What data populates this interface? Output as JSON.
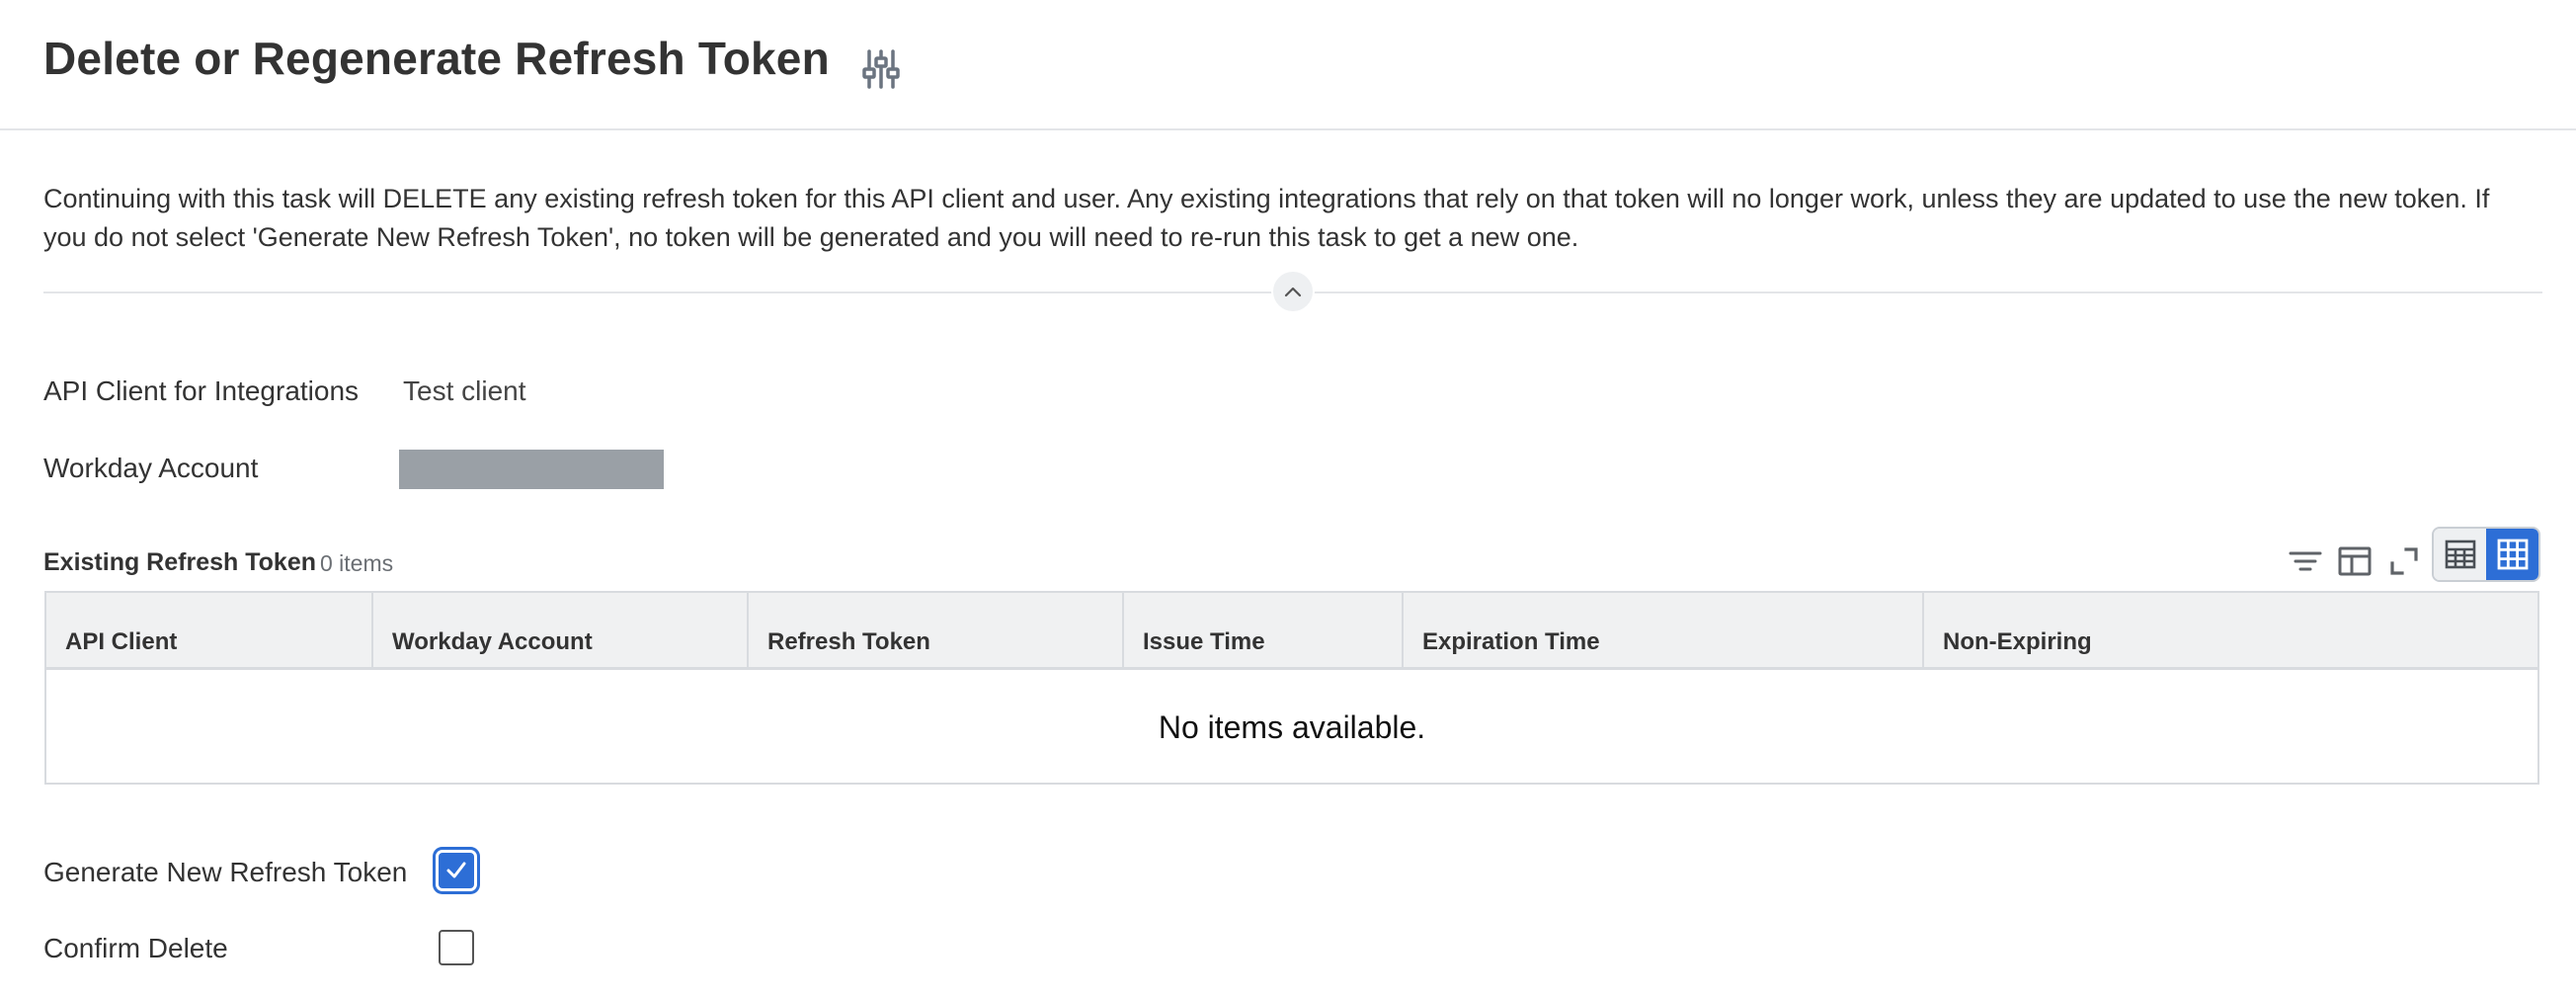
{
  "header": {
    "title": "Delete or Regenerate Refresh Token",
    "related_actions_icon": "related-actions-sliders-icon"
  },
  "instructions": {
    "text": "Continuing with this task will DELETE any existing refresh token for this API client and user. Any existing integrations that rely on that token will no longer work, unless they are updated to use the new token. If you do not select 'Generate New Refresh Token', no token will be generated and you will need to re-run this task to get a new one.",
    "collapse_icon": "chevron-up-icon"
  },
  "fields": {
    "api_client_label": "API Client for Integrations",
    "api_client_value": "Test client",
    "workday_account_label": "Workday Account"
  },
  "grid": {
    "title": "Existing Refresh Token",
    "count": "0 items",
    "columns": [
      "API Client",
      "Workday Account",
      "Refresh Token",
      "Issue Time",
      "Expiration Time",
      "Non-Expiring"
    ],
    "empty_message": "No items available.",
    "toolbar_icons": [
      "filter-icon",
      "columns-icon",
      "fullscreen-icon",
      "table-view-icon",
      "grid-view-icon"
    ]
  },
  "options": {
    "generate_label": "Generate New Refresh Token",
    "generate_checked": true,
    "confirm_label": "Confirm Delete",
    "confirm_checked": false
  },
  "colors": {
    "accent": "#2d6ed6",
    "redacted": "#9aa0a6",
    "icon_gray": "#5f6368"
  }
}
